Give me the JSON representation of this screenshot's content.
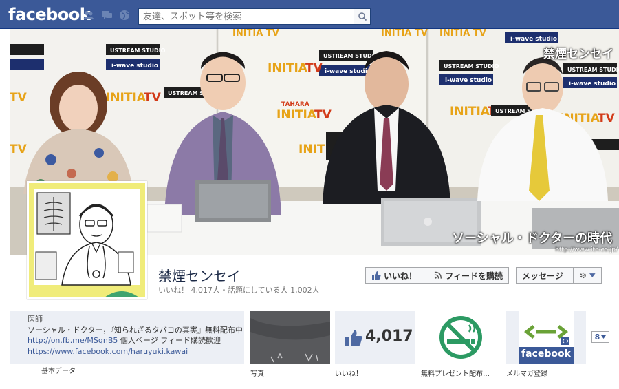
{
  "topbar": {
    "logo": "facebook",
    "search_placeholder": "友達、スポット等を検索",
    "bg_color": "#3b5998"
  },
  "cover": {
    "title": "禁煙センセイ",
    "subtitle": "ソーシャル・ドクターの時代",
    "url": "http://www.itn.co.jp/",
    "banner_words": [
      "USTREAM STUDIO",
      "i-wave studio",
      "INITIA TV",
      "TAHARA"
    ]
  },
  "page": {
    "name": "禁煙センセイ",
    "stats": "いいね！ 4,017人・話題にしている人 1,002人"
  },
  "buttons": {
    "like": "いいね！",
    "subscribe": "フィードを購読",
    "message": "メッセージ",
    "settings_icon": "gear-icon"
  },
  "info": {
    "category": "医師",
    "line1": "ソーシャル・ドクター，『知られざるタバコの真実』無料配布中",
    "link1": "http://on.fb.me/MSqnB5",
    "line2_suffix": " 個人ページ フィード購読歓迎",
    "link2": "https://www.facebook.com/haruyuki.kawai",
    "tab_label": "基本データ"
  },
  "tiles": [
    {
      "label": "写真"
    },
    {
      "label": "いいね！",
      "count": "4,017"
    },
    {
      "label": "無料プレゼント配布…"
    },
    {
      "label": "メルマガ登録",
      "logo_text": "facebook"
    }
  ],
  "more": {
    "count": "8"
  }
}
